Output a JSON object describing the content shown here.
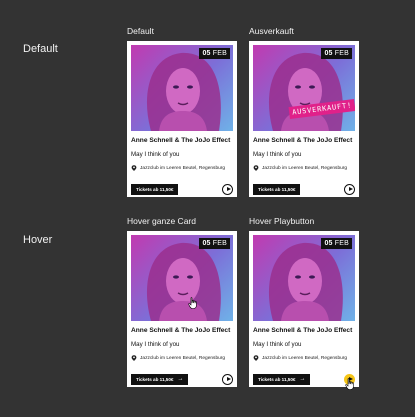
{
  "row_labels": {
    "default": "Default",
    "hover": "Hover"
  },
  "column_labels": {
    "default": "Default",
    "sold_out": "Ausverkauft",
    "hover_card": "Hover ganze Card",
    "hover_play": "Hover Playbutton"
  },
  "card": {
    "date_day": "05",
    "date_month": "FEB",
    "title": "Anne Schnell & The JoJo Effect",
    "subtitle": "May I think of you",
    "venue": "Jazzclub im Leeren Beutel, Regensburg",
    "ticket_label": "Tickets ab 11,50€",
    "ticket_arrow": "→",
    "sold_out_stamp": "AUSVERKAUFT!"
  },
  "icons": {
    "location": "location-pin-icon",
    "play": "play-icon",
    "arrow": "arrow-right-icon",
    "cursor": "hand-pointer-icon"
  },
  "colors": {
    "background": "#333333",
    "card": "#ffffff",
    "button": "#111111",
    "sold_out": "#e0218a",
    "play_hover": "#f5c518",
    "photo_magenta": "#c13ab0",
    "photo_blue": "#6fb2e8"
  }
}
